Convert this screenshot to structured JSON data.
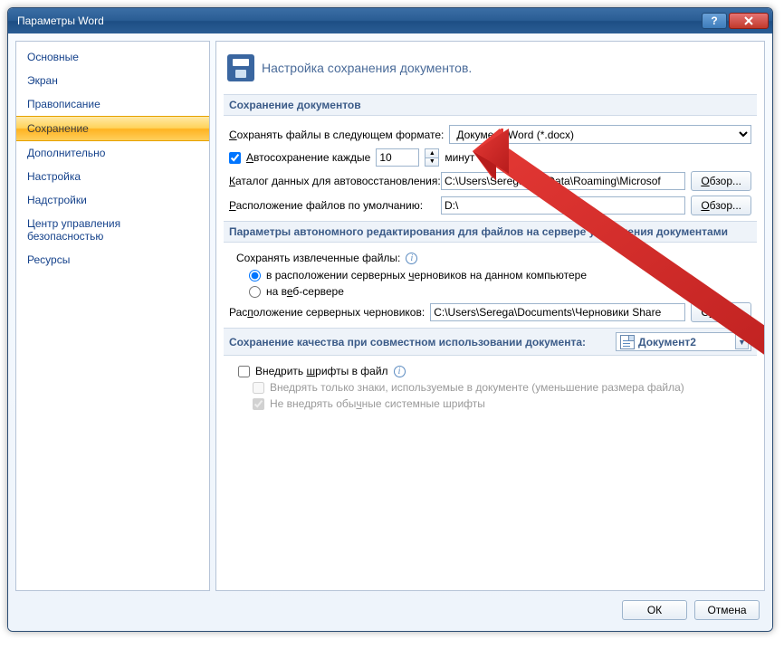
{
  "window": {
    "title": "Параметры Word"
  },
  "sidebar": {
    "items": [
      "Основные",
      "Экран",
      "Правописание",
      "Сохранение",
      "Дополнительно",
      "Настройка",
      "Надстройки",
      "Центр управления безопасностью",
      "Ресурсы"
    ],
    "selected_index": 3
  },
  "header": "Настройка сохранения документов.",
  "group1": {
    "title": "Сохранение документов",
    "save_format_label": "Сохранять файлы в следующем формате:",
    "save_format_value": "Документ Word (*.docx)",
    "autosave_checked": true,
    "autosave_label": "Автосохранение каждые",
    "autosave_value": "10",
    "autosave_unit": "минут",
    "autorecover_label": "Каталог данных для автовосстановления:",
    "autorecover_value": "C:\\Users\\Serega\\AppData\\Roaming\\Microsof",
    "default_loc_label": "Расположение файлов по умолчанию:",
    "default_loc_value": "D:\\",
    "browse": "Обзор..."
  },
  "group2": {
    "title": "Параметры автономного редактирования для файлов на сервере управления документами",
    "save_extracted_label": "Сохранять извлеченные файлы:",
    "opt1": "в расположении серверных черновиков на данном компьютере",
    "opt2": "на веб-сервере",
    "drafts_label": "Расположение серверных черновиков:",
    "drafts_value": "C:\\Users\\Serega\\Documents\\Черновики Share",
    "browse": "Обзор..."
  },
  "group3": {
    "title": "Сохранение качества при совместном использовании документа:",
    "doc_name": "Документ2",
    "embed_label": "Внедрить шрифты в файл",
    "embed_sub1": "Внедрять только знаки, используемые в документе (уменьшение размера файла)",
    "embed_sub2": "Не внедрять обычные системные шрифты"
  },
  "footer": {
    "ok": "ОК",
    "cancel": "Отмена"
  }
}
